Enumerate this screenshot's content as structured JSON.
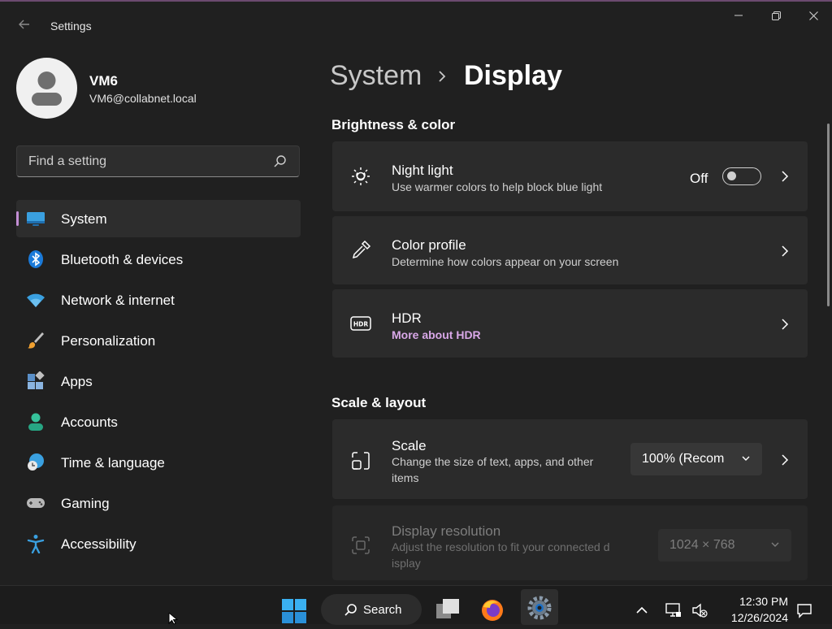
{
  "window": {
    "title": "Settings",
    "back_icon": "arrow-left-icon"
  },
  "user": {
    "name": "VM6",
    "email": "VM6@collabnet.local"
  },
  "search": {
    "placeholder": "Find a setting"
  },
  "nav": {
    "items": [
      {
        "label": "System",
        "icon": "system-monitor-icon",
        "active": true
      },
      {
        "label": "Bluetooth & devices",
        "icon": "bluetooth-icon"
      },
      {
        "label": "Network & internet",
        "icon": "wifi-icon"
      },
      {
        "label": "Personalization",
        "icon": "paintbrush-icon"
      },
      {
        "label": "Apps",
        "icon": "apps-icon"
      },
      {
        "label": "Accounts",
        "icon": "accounts-icon"
      },
      {
        "label": "Time & language",
        "icon": "globe-clock-icon"
      },
      {
        "label": "Gaming",
        "icon": "gamepad-icon"
      },
      {
        "label": "Accessibility",
        "icon": "accessibility-icon"
      }
    ]
  },
  "breadcrumb": {
    "parent": "System",
    "current": "Display"
  },
  "sections": {
    "brightness": {
      "title": "Brightness & color",
      "night_light": {
        "title": "Night light",
        "subtitle": "Use warmer colors to help block blue light",
        "toggle_label": "Off",
        "toggle_on": false
      },
      "color_profile": {
        "title": "Color profile",
        "subtitle": "Determine how colors appear on your screen"
      },
      "hdr": {
        "title": "HDR",
        "link": "More about HDR"
      }
    },
    "scale_layout": {
      "title": "Scale & layout",
      "scale": {
        "title": "Scale",
        "subtitle_line1": "Change the size of text, apps, and other",
        "subtitle_line2": "items",
        "value": "100% (Recom"
      },
      "resolution": {
        "title": "Display resolution",
        "subtitle_line1": "Adjust the resolution to fit your connected d",
        "subtitle_line2": "isplay",
        "value": "1024 × 768"
      }
    }
  },
  "taskbar": {
    "search_label": "Search",
    "time": "12:30 PM",
    "date": "12/26/2024"
  },
  "colors": {
    "background": "#202020",
    "card": "#2b2b2b",
    "accent": "#c38ed4",
    "link": "#d9a8e8"
  }
}
